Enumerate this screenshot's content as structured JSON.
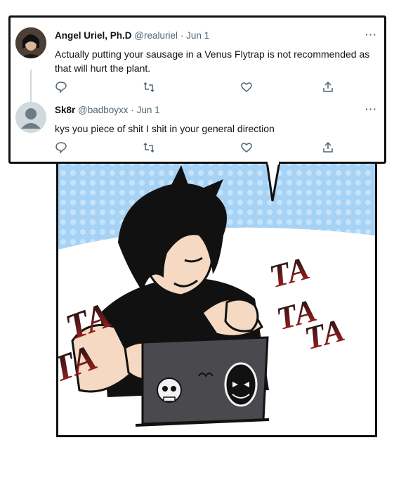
{
  "tweets": [
    {
      "name": "Angel Uriel, Ph.D",
      "handle": "@realuriel",
      "separator": "·",
      "date": "Jun 1",
      "text": "Actually putting your sausage in a Venus Flytrap is not recommended as that will hurt the plant.",
      "more": "···"
    },
    {
      "name": "Sk8r",
      "handle": "@badboyxx",
      "separator": "·",
      "date": "Jun 1",
      "text": "kys you piece of shit I shit in your general direction",
      "more": "···"
    }
  ],
  "comic": {
    "sfx_left": [
      "TA",
      "TA"
    ],
    "sfx_right": [
      "TA",
      "TA",
      "TA"
    ]
  },
  "colors": {
    "sky_blue": "#a6d3f5",
    "sfx_red": "#b22222",
    "laptop": "#4a4a4e"
  },
  "icons": [
    "reply-icon",
    "retweet-icon",
    "like-icon",
    "share-icon",
    "more-icon",
    "avatar-icon"
  ]
}
